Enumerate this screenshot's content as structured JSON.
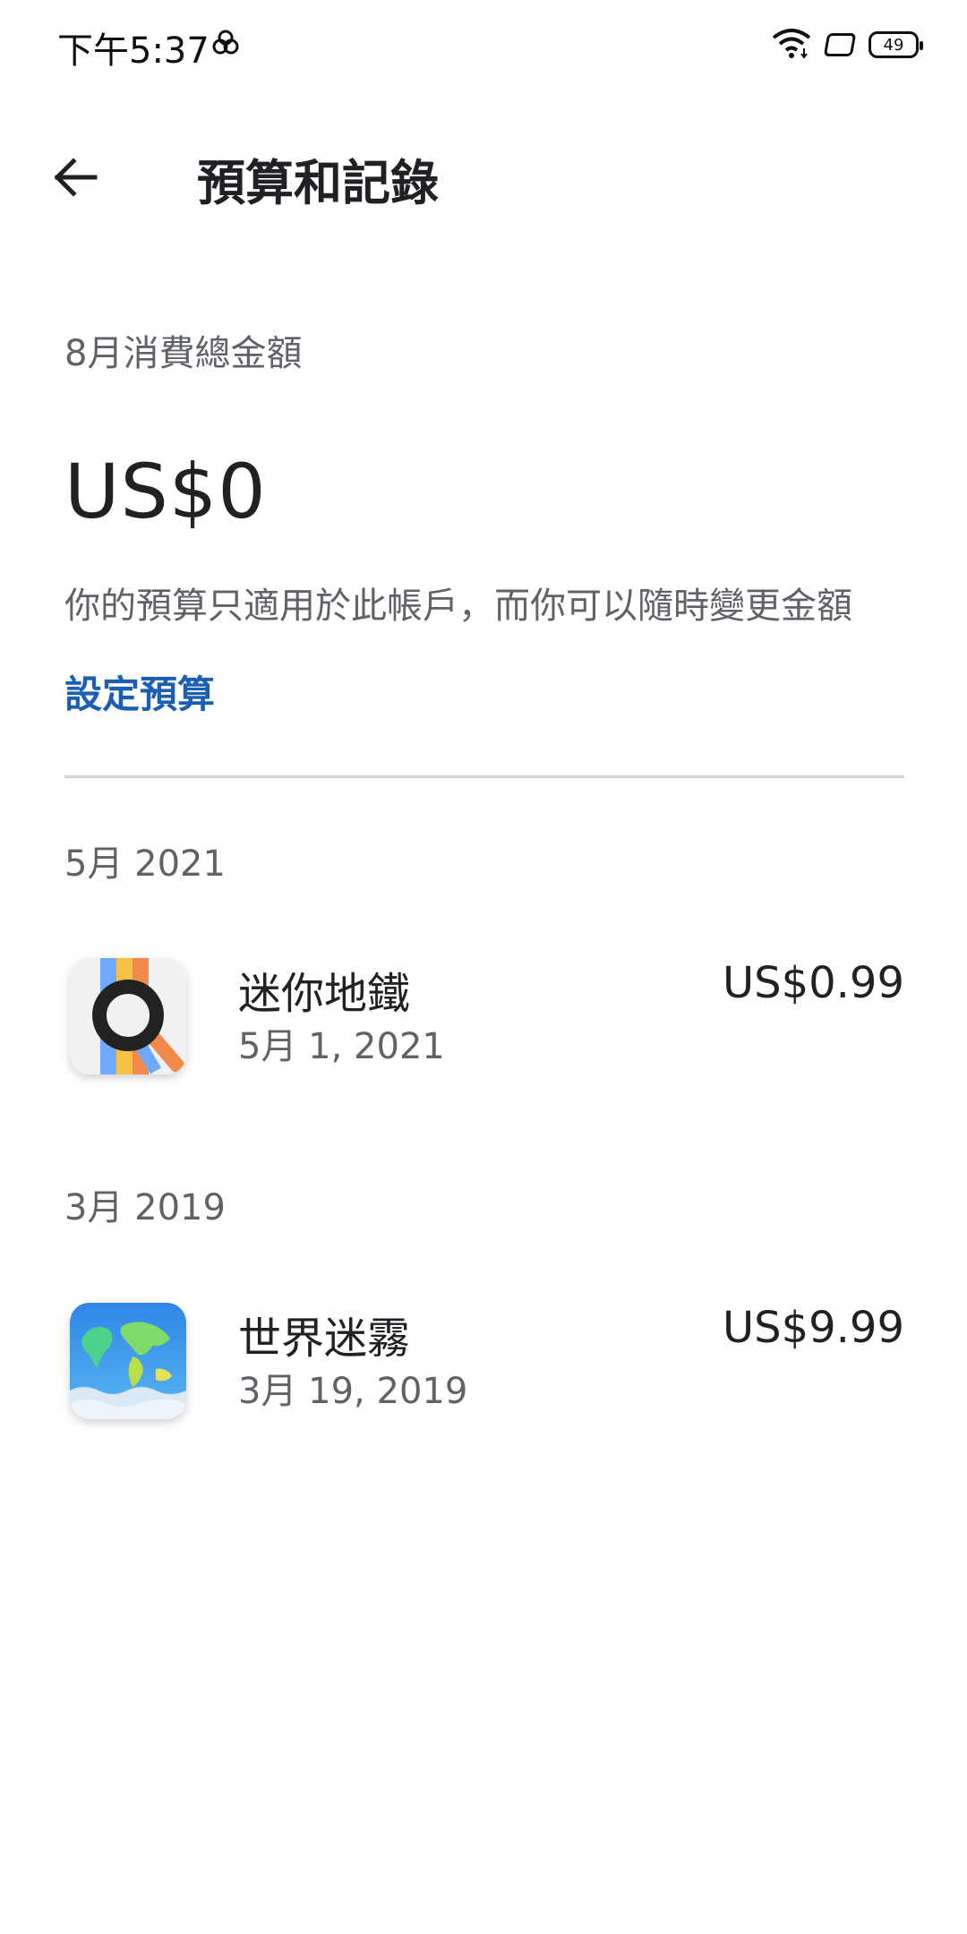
{
  "status": {
    "time": "下午5:37",
    "battery": "49",
    "icons": [
      "nfc-icon",
      "wifi-icon",
      "screen-rotate-icon",
      "battery-icon"
    ]
  },
  "header": {
    "title": "預算和記錄",
    "back_icon": "arrow-back-icon"
  },
  "summary": {
    "label": "8月消費總金額",
    "amount": "US$0",
    "note": "你的預算只適用於此帳戶，而你可以隨時變更金額",
    "set_budget": "設定預算",
    "link_color": "#1a5fb4"
  },
  "history": [
    {
      "month": "5月 2021",
      "items": [
        {
          "name": "迷你地鐵",
          "date": "5月 1, 2021",
          "price": "US$0.99",
          "icon": "mini-metro-app-icon"
        }
      ]
    },
    {
      "month": "3月 2019",
      "items": [
        {
          "name": "世界迷霧",
          "date": "3月 19, 2019",
          "price": "US$9.99",
          "icon": "fog-of-world-app-icon"
        }
      ]
    }
  ]
}
